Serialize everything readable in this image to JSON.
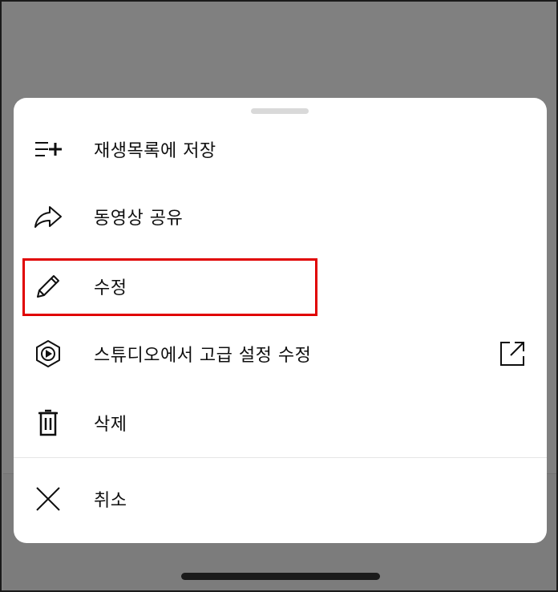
{
  "menu": {
    "items": [
      {
        "id": "save-to-playlist",
        "label": "재생목록에 저장",
        "icon": "playlist-add-icon"
      },
      {
        "id": "share-video",
        "label": "동영상 공유",
        "icon": "share-icon"
      },
      {
        "id": "edit",
        "label": "수정",
        "icon": "pencil-icon"
      },
      {
        "id": "studio-advanced",
        "label": "스튜디오에서 고급 설정 수정",
        "icon": "studio-icon",
        "trailing_icon": "external-link-icon"
      },
      {
        "id": "delete",
        "label": "삭제",
        "icon": "trash-icon"
      }
    ],
    "cancel": {
      "label": "취소",
      "icon": "close-icon"
    }
  },
  "colors": {
    "overlay": "#808080",
    "sheet": "#ffffff",
    "text": "#0f0f0f",
    "highlight": "#e00000"
  }
}
